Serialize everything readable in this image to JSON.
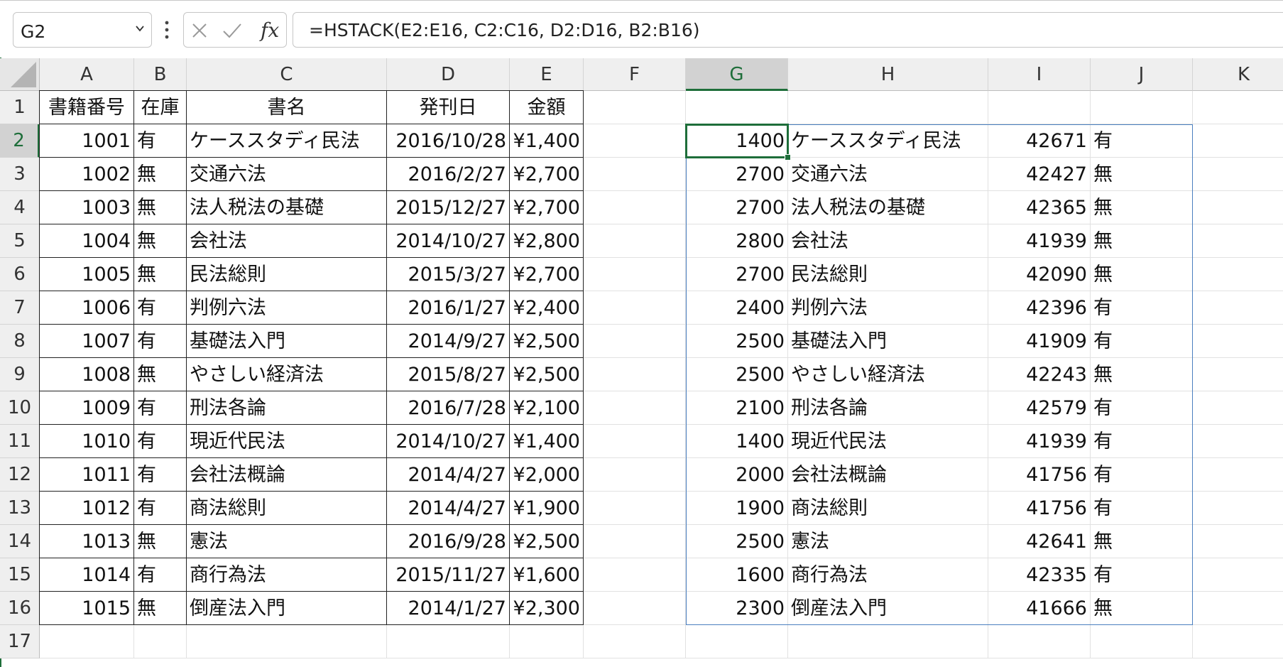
{
  "name_box": {
    "value": "G2"
  },
  "formula_bar": {
    "formula": "=HSTACK(E2:E16, C2:C16, D2:D16, B2:B16)",
    "fx_label": "fx"
  },
  "columns": [
    "A",
    "B",
    "C",
    "D",
    "E",
    "F",
    "G",
    "H",
    "I",
    "J",
    "K"
  ],
  "selected_column": "G",
  "rows": [
    "1",
    "2",
    "3",
    "4",
    "5",
    "6",
    "7",
    "8",
    "9",
    "10",
    "11",
    "12",
    "13",
    "14",
    "15",
    "16",
    "17"
  ],
  "selected_row": "2",
  "headers": [
    "書籍番号",
    "在庫",
    "書名",
    "発刊日",
    "金額"
  ],
  "books": [
    [
      "1001",
      "有",
      "ケーススタディ民法",
      "2016/10/28",
      "¥1,400"
    ],
    [
      "1002",
      "無",
      "交通六法",
      "2016/2/27",
      "¥2,700"
    ],
    [
      "1003",
      "無",
      "法人税法の基礎",
      "2015/12/27",
      "¥2,700"
    ],
    [
      "1004",
      "無",
      "会社法",
      "2014/10/27",
      "¥2,800"
    ],
    [
      "1005",
      "無",
      "民法総則",
      "2015/3/27",
      "¥2,700"
    ],
    [
      "1006",
      "有",
      "判例六法",
      "2016/1/27",
      "¥2,400"
    ],
    [
      "1007",
      "有",
      "基礎法入門",
      "2014/9/27",
      "¥2,500"
    ],
    [
      "1008",
      "無",
      "やさしい経済法",
      "2015/8/27",
      "¥2,500"
    ],
    [
      "1009",
      "有",
      "刑法各論",
      "2016/7/28",
      "¥2,100"
    ],
    [
      "1010",
      "有",
      "現近代民法",
      "2014/10/27",
      "¥1,400"
    ],
    [
      "1011",
      "有",
      "会社法概論",
      "2014/4/27",
      "¥2,000"
    ],
    [
      "1012",
      "有",
      "商法総則",
      "2014/4/27",
      "¥1,900"
    ],
    [
      "1013",
      "無",
      "憲法",
      "2016/9/28",
      "¥2,500"
    ],
    [
      "1014",
      "有",
      "商行為法",
      "2015/11/27",
      "¥1,600"
    ],
    [
      "1015",
      "無",
      "倒産法入門",
      "2014/1/27",
      "¥2,300"
    ]
  ],
  "spill": [
    [
      "1400",
      "ケーススタディ民法",
      "42671",
      "有"
    ],
    [
      "2700",
      "交通六法",
      "42427",
      "無"
    ],
    [
      "2700",
      "法人税法の基礎",
      "42365",
      "無"
    ],
    [
      "2800",
      "会社法",
      "41939",
      "無"
    ],
    [
      "2700",
      "民法総則",
      "42090",
      "無"
    ],
    [
      "2400",
      "判例六法",
      "42396",
      "有"
    ],
    [
      "2500",
      "基礎法入門",
      "41909",
      "有"
    ],
    [
      "2500",
      "やさしい経済法",
      "42243",
      "無"
    ],
    [
      "2100",
      "刑法各論",
      "42579",
      "有"
    ],
    [
      "1400",
      "現近代民法",
      "41939",
      "有"
    ],
    [
      "2000",
      "会社法概論",
      "41756",
      "有"
    ],
    [
      "1900",
      "商法総則",
      "41756",
      "有"
    ],
    [
      "2500",
      "憲法",
      "42641",
      "無"
    ],
    [
      "1600",
      "商行為法",
      "42335",
      "有"
    ],
    [
      "2300",
      "倒産法入門",
      "41666",
      "無"
    ]
  ],
  "colors": {
    "accent_green": "#1e6e3a",
    "spill_border": "#4a7fc0"
  }
}
